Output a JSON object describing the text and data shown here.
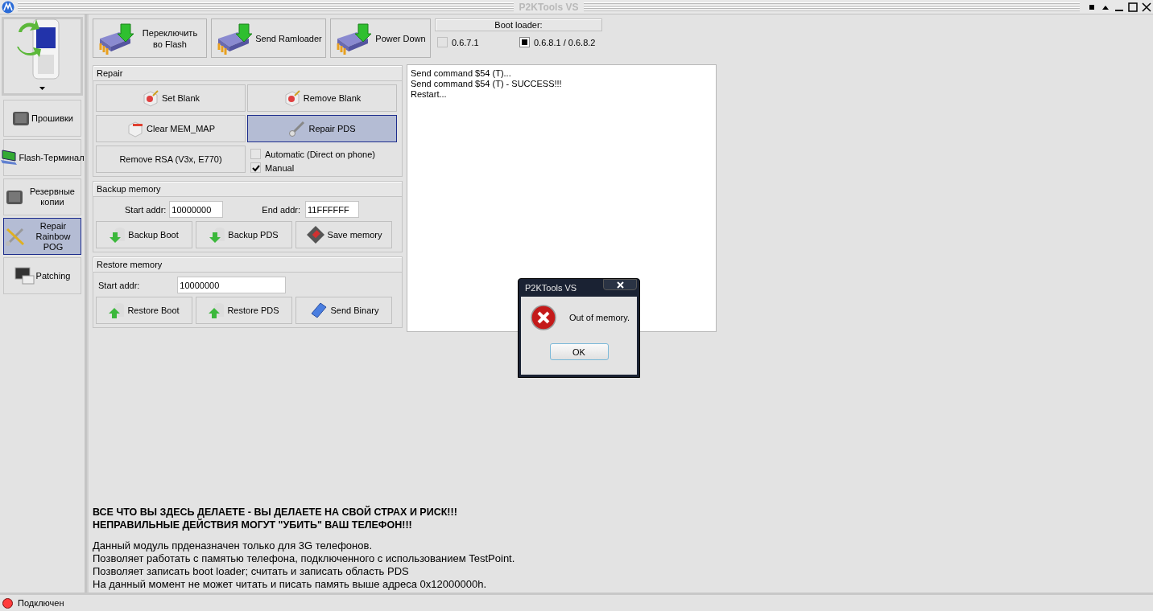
{
  "window": {
    "title": "P2KTools VS"
  },
  "sidebar": {
    "items": [
      {
        "label": "Прошивки",
        "selected": false
      },
      {
        "label": "Flash-Терминал",
        "selected": false
      },
      {
        "label": "Резервные копии",
        "selected": false
      },
      {
        "label": "Repair Rainbow POG",
        "selected": true
      },
      {
        "label": "Patching",
        "selected": false
      }
    ]
  },
  "toolbar": {
    "buttons": [
      {
        "label": "Переключить во Flash"
      },
      {
        "label": "Send Ramloader"
      },
      {
        "label": "Power Down"
      }
    ]
  },
  "boot_loader": {
    "title": "Boot loader:",
    "options": [
      {
        "label": "0.6.7.1",
        "selected": false
      },
      {
        "label": "0.6.8.1 / 0.6.8.2",
        "selected": true
      }
    ]
  },
  "repair": {
    "title": "Repair",
    "buttons": [
      {
        "label": "Set Blank",
        "selected": false
      },
      {
        "label": "Remove Blank",
        "selected": false
      },
      {
        "label": "Clear MEM_MAP",
        "selected": false
      },
      {
        "label": "Repair PDS",
        "selected": true
      },
      {
        "label": "Remove RSA (V3x, E770)",
        "selected": false
      }
    ],
    "options": [
      {
        "label": "Automatic (Direct on phone)",
        "checked": false
      },
      {
        "label": "Manual",
        "checked": true
      }
    ]
  },
  "backup": {
    "title": "Backup memory",
    "fields": [
      {
        "label": "Start addr:",
        "value": "10000000"
      },
      {
        "label": "End addr:",
        "value": "11FFFFFF"
      }
    ],
    "buttons": [
      {
        "label": "Backup Boot"
      },
      {
        "label": "Backup PDS"
      },
      {
        "label": "Save memory"
      }
    ]
  },
  "restore": {
    "title": "Restore memory",
    "fields": [
      {
        "label": "Start addr:",
        "value": "10000000"
      }
    ],
    "buttons": [
      {
        "label": "Restore Boot"
      },
      {
        "label": "Restore PDS"
      },
      {
        "label": "Send Binary"
      }
    ]
  },
  "log": {
    "lines": [
      "Send command $54 (T)...",
      "Send command $54 (T) -  SUCCESS!!!",
      "Restart..."
    ]
  },
  "dialog": {
    "title": "P2KTools VS",
    "message": "Out of memory.",
    "button": "OK"
  },
  "notice": {
    "warnings": [
      "ВСЕ ЧТО ВЫ ЗДЕСЬ ДЕЛАЕТЕ - ВЫ ДЕЛАЕТЕ НА СВОЙ СТРАХ И РИСК!!!",
      "НЕПРАВИЛЬНЫЕ ДЕЙСТВИЯ МОГУТ \"УБИТЬ\" ВАШ ТЕЛЕФОН!!!"
    ],
    "lines": [
      "Данный модуль прденазначен только для 3G телефонов.",
      "Позволяет работать с памятью телефона, подключенного с использованием TestPoint.",
      "Позволяет записать boot loader; считать и записать область PDS",
      "На данный момент не может читать и писать память выше адреса 0x12000000h."
    ]
  },
  "status_bar": {
    "text": "Подключен",
    "color": "#ff3b3b"
  }
}
